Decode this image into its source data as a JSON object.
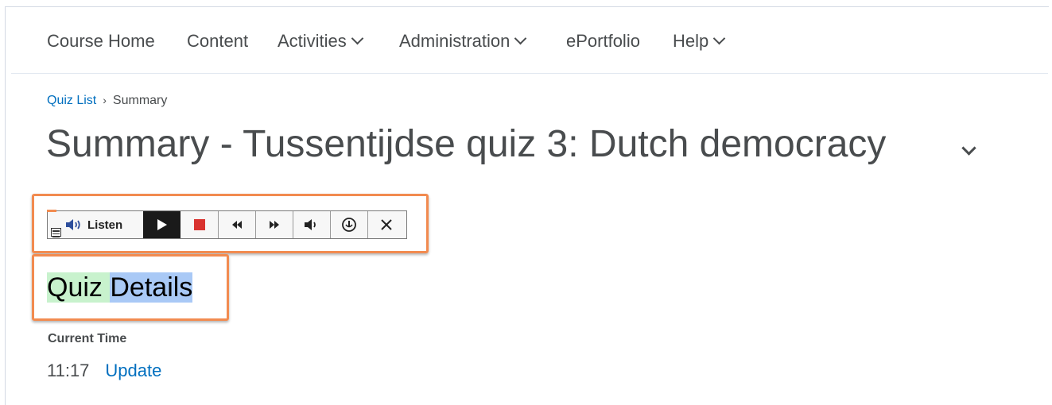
{
  "nav": {
    "items": [
      {
        "label": "Course Home",
        "dropdown": false
      },
      {
        "label": "Content",
        "dropdown": false
      },
      {
        "label": "Activities",
        "dropdown": true
      },
      {
        "label": "Administration",
        "dropdown": true
      },
      {
        "label": "ePortfolio",
        "dropdown": false
      },
      {
        "label": "Help",
        "dropdown": true
      }
    ]
  },
  "breadcrumb": {
    "link": "Quiz List",
    "separator": "›",
    "current": "Summary"
  },
  "page": {
    "title": "Summary - Tussentijdse quiz 3: Dutch democracy"
  },
  "toolbar": {
    "listen_label": "Listen",
    "buttons": [
      "menu-icon",
      "play-icon",
      "stop-icon",
      "rewind-icon",
      "fast-forward-icon",
      "volume-icon",
      "settings-icon",
      "close-icon"
    ]
  },
  "quiz_details": {
    "word1": "Quiz",
    "word2": "Details"
  },
  "current_time": {
    "label": "Current Time",
    "value": "11:17",
    "update_link": "Update"
  },
  "colors": {
    "accent_link": "#006fbf",
    "highlight_box": "#f28b50",
    "word_highlight_green": "#c8f2cd",
    "word_highlight_blue": "#a9c9f6",
    "stop_red": "#d9332f"
  }
}
